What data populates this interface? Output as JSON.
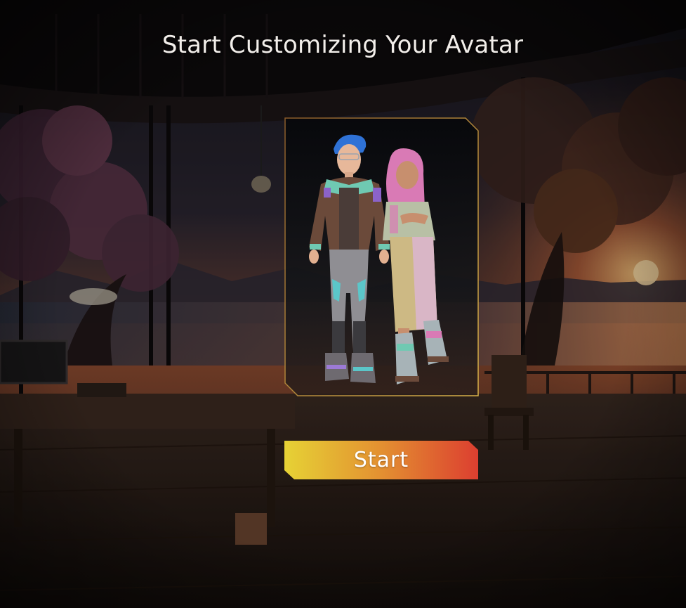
{
  "screen": {
    "title": "Start Customizing Your Avatar"
  },
  "card": {
    "characters": [
      "male-avatar",
      "female-avatar"
    ],
    "border_color": "#c9a13a"
  },
  "start_button": {
    "label": "Start",
    "gradient_start": "#e6d235",
    "gradient_end": "#dc3f30"
  }
}
